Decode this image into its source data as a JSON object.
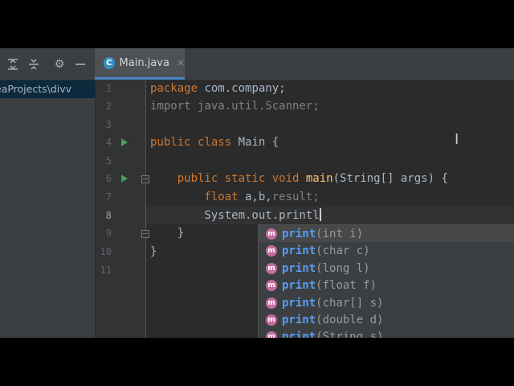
{
  "toolbar": {
    "icons": [
      "expand-all-icon",
      "collapse-all-icon",
      "gear-icon",
      "minimize-icon"
    ],
    "gear_glyph": "⚙"
  },
  "tab": {
    "label": "Main.java",
    "close": "×",
    "icon_letter": "C"
  },
  "project": {
    "path": "eaProjects\\divv"
  },
  "line_numbers": [
    "1",
    "2",
    "3",
    "4",
    "5",
    "6",
    "7",
    "8",
    "9",
    "10",
    "11"
  ],
  "code": {
    "l1_kw": "package",
    "l1_rest": " com.company;",
    "l2": "import java.util.Scanner;",
    "l4_kw": "public class",
    "l4_rest": " Main {",
    "l6_kw": "    public static void",
    "l6_fn": " main",
    "l6_rest": "(String[] args) {",
    "l7_kw": "        float",
    "l7_rest": " a,b,",
    "l7_muted": "result;",
    "l8": "        System.out.printl",
    "l9": "    }",
    "l10": "}"
  },
  "completion": {
    "badge": "m",
    "items": [
      {
        "name": "print",
        "params": "(int i)"
      },
      {
        "name": "print",
        "params": "(char c)"
      },
      {
        "name": "print",
        "params": "(long l)"
      },
      {
        "name": "print",
        "params": "(float f)"
      },
      {
        "name": "print",
        "params": "(char[] s)"
      },
      {
        "name": "print",
        "params": "(double d)"
      },
      {
        "name": "print",
        "params": "(String s)"
      }
    ]
  },
  "colors": {
    "keyword": "#cc7832",
    "function": "#ffc66d",
    "completion_name": "#589df6",
    "run_arrow": "#499c54",
    "tab_underline": "#4a88c7"
  }
}
